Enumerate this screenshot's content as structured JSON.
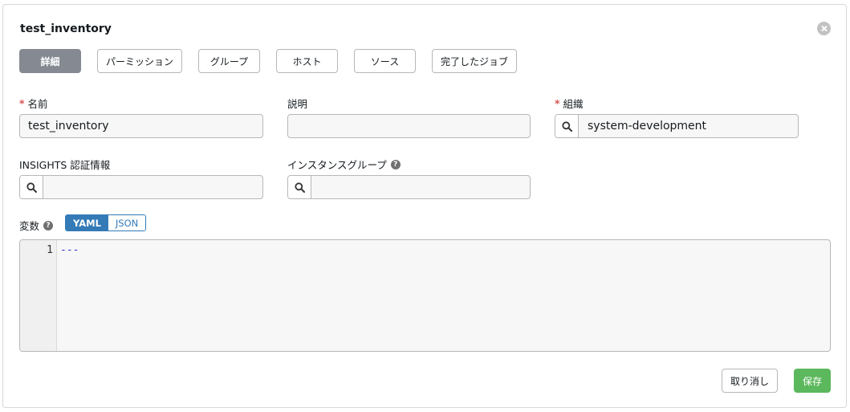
{
  "dialog": {
    "title": "test_inventory"
  },
  "tabs": [
    {
      "label": "詳細",
      "active": true
    },
    {
      "label": "パーミッション",
      "active": false
    },
    {
      "label": "グループ",
      "active": false
    },
    {
      "label": "ホスト",
      "active": false
    },
    {
      "label": "ソース",
      "active": false
    },
    {
      "label": "完了したジョブ",
      "active": false
    }
  ],
  "form": {
    "name": {
      "label": "名前",
      "required": true,
      "value": "test_inventory"
    },
    "description": {
      "label": "説明",
      "required": false,
      "value": ""
    },
    "organization": {
      "label": "組織",
      "required": true,
      "value": "system-development"
    },
    "insights": {
      "label": "INSIGHTS 認証情報",
      "value": ""
    },
    "instance_groups": {
      "label": "インスタンスグループ",
      "value": ""
    },
    "variables": {
      "label": "変数",
      "modes": [
        "YAML",
        "JSON"
      ],
      "selected_mode": "YAML",
      "lines": [
        {
          "number": "1",
          "text": "---"
        }
      ]
    },
    "required_marker": "*",
    "help_glyph": "?"
  },
  "actions": {
    "cancel_label": "取り消し",
    "save_label": "保存"
  },
  "colors": {
    "save": "#5cb85c",
    "active_tab": "#848992",
    "toggle": "#337ab7",
    "required": "#d9534f"
  }
}
